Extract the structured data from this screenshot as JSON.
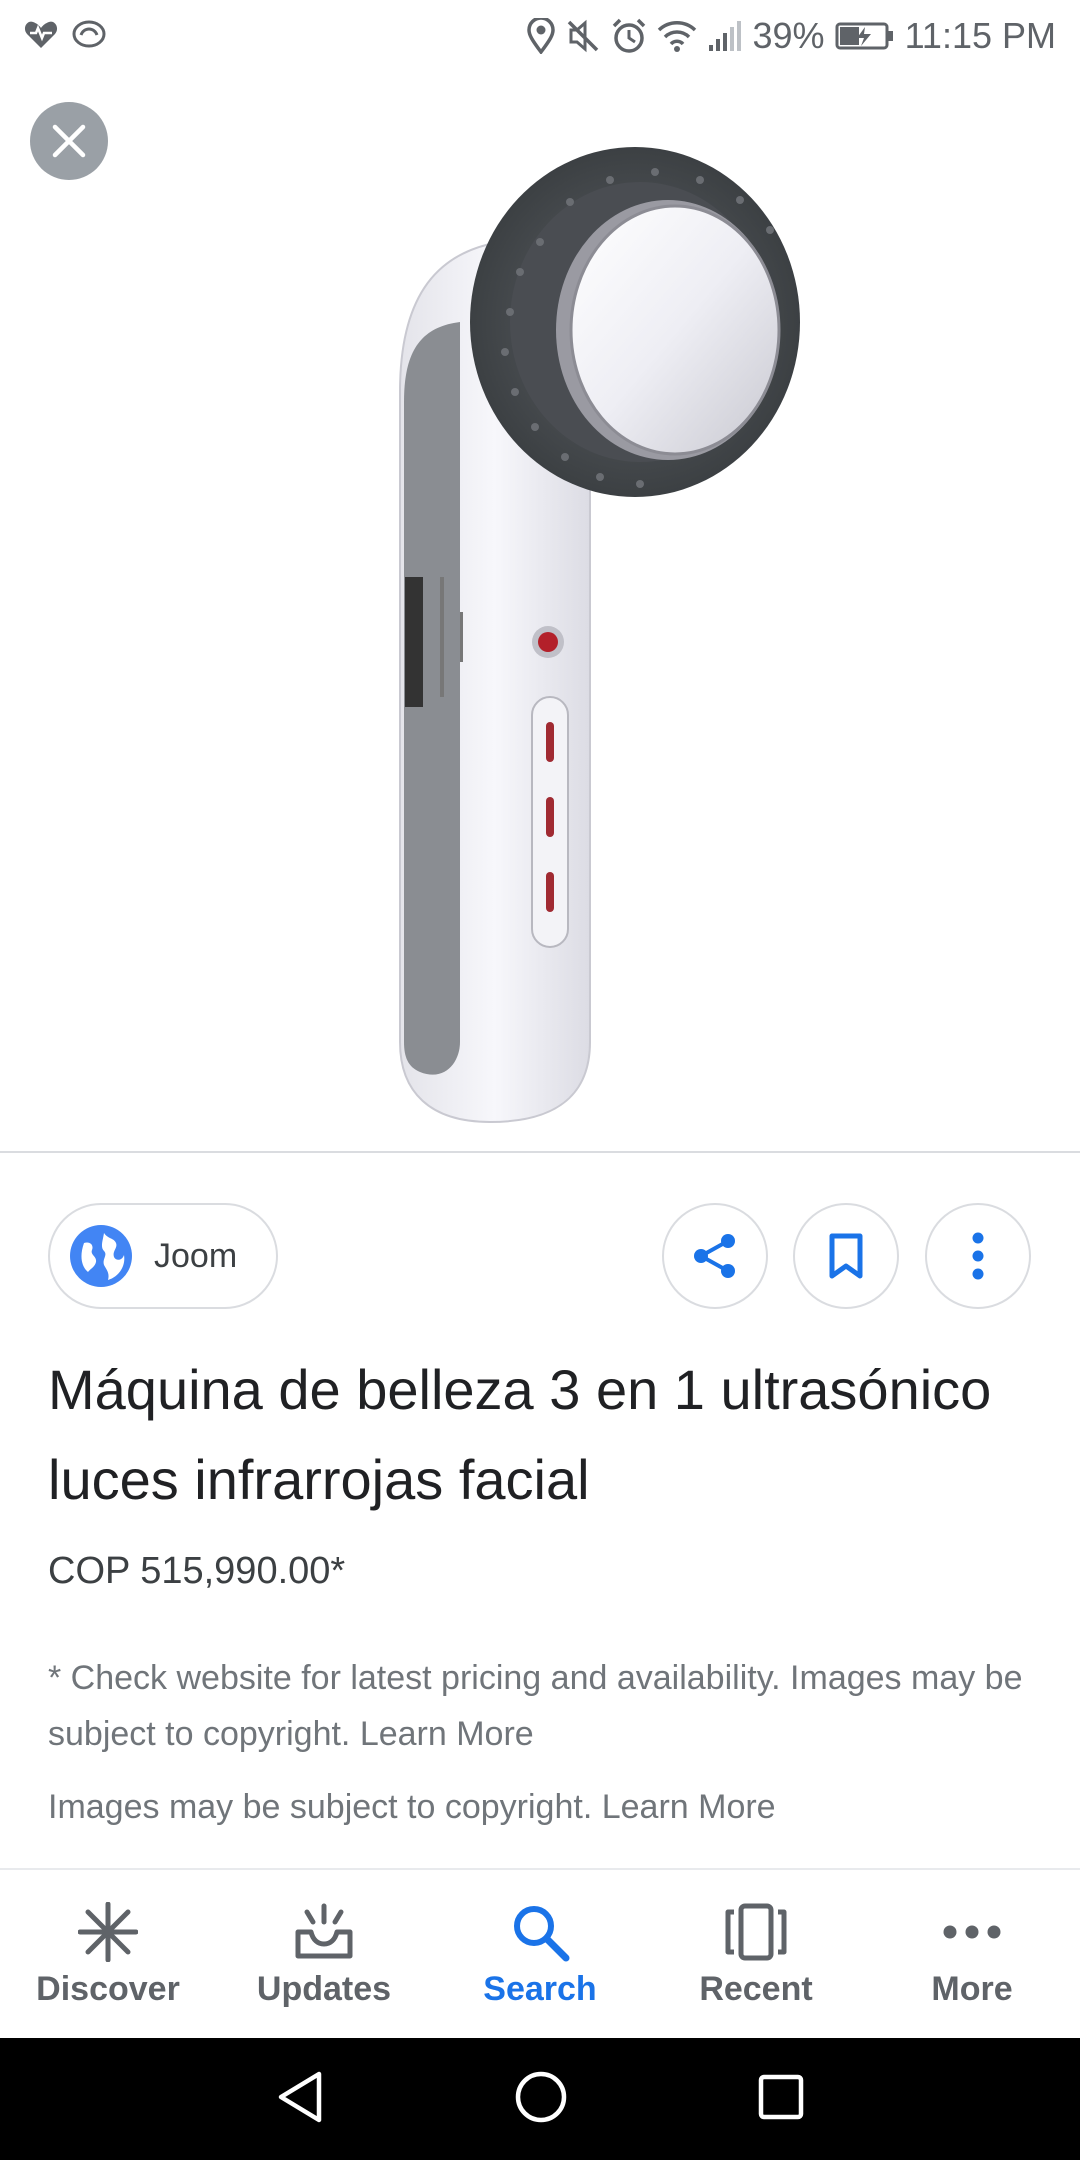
{
  "status_bar": {
    "battery": "39%",
    "time": "11:15 PM"
  },
  "source": {
    "name": "Joom"
  },
  "product": {
    "title": "Máquina de belleza 3 en 1 ultrasónico luces infrarrojas facial",
    "price": "COP 515,990.00*"
  },
  "notes": {
    "disclaimer": "* Check website for latest pricing and availability. Images may be subject to copyright. Learn More",
    "copyright": "Images may be subject to copyright. Learn More"
  },
  "bottom_nav": {
    "items": [
      {
        "label": "Discover",
        "icon": "asterisk-icon"
      },
      {
        "label": "Updates",
        "icon": "inbox-updates-icon"
      },
      {
        "label": "Search",
        "icon": "search-icon"
      },
      {
        "label": "Recent",
        "icon": "recent-cards-icon"
      },
      {
        "label": "More",
        "icon": "more-horiz-icon"
      }
    ],
    "active": "Search"
  },
  "colors": {
    "accent": "#1a73e8",
    "globe": "#4285f4",
    "close_button": "#9aa0a6"
  }
}
